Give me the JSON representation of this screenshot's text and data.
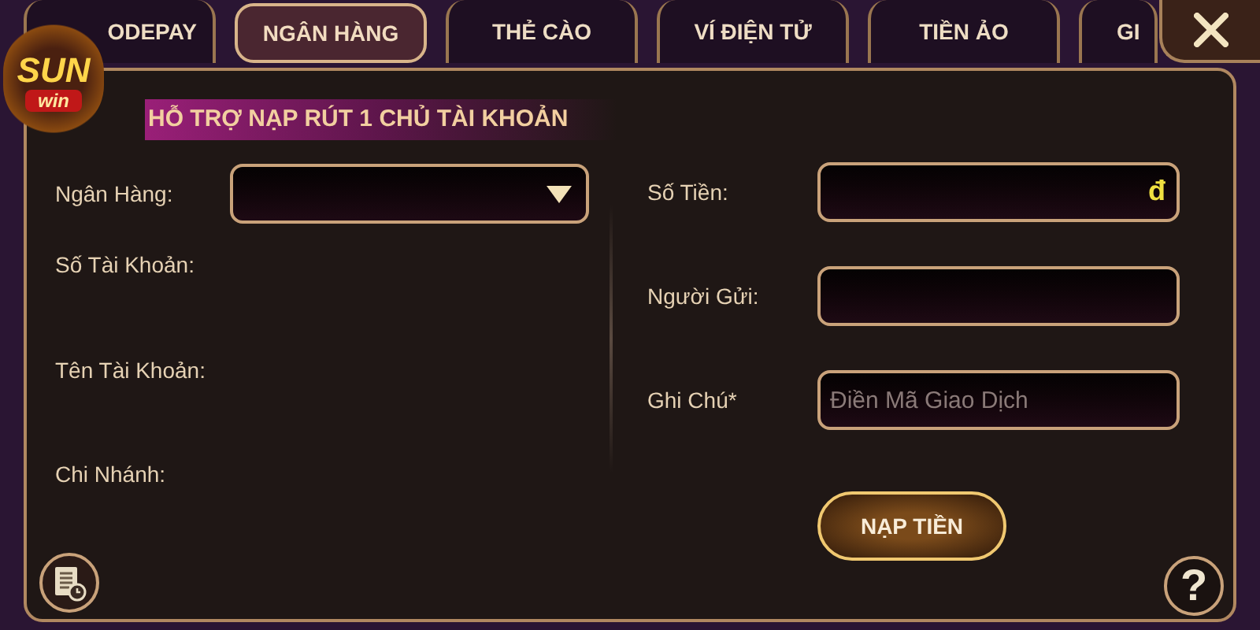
{
  "logo": {
    "top": "SUN",
    "bottom": "win"
  },
  "tabs": [
    {
      "label": "ODEPAY",
      "selected": false
    },
    {
      "label": "NGÂN HÀNG",
      "selected": true
    },
    {
      "label": "THẺ CÀO",
      "selected": false
    },
    {
      "label": "VÍ ĐIỆN TỬ",
      "selected": false
    },
    {
      "label": "TIỀN ẢO",
      "selected": false
    },
    {
      "label": "GI",
      "selected": false
    }
  ],
  "banner": "HỖ TRỢ NẠP RÚT 1 CHỦ TÀI KHOẢN",
  "left_fields": [
    {
      "label": "Ngân Hàng:",
      "kind": "dropdown"
    },
    {
      "label": "Số Tài Khoản:",
      "kind": "text"
    },
    {
      "label": "Tên Tài Khoản:",
      "kind": "text"
    },
    {
      "label": "Chi Nhánh:",
      "kind": "text"
    }
  ],
  "right_fields": [
    {
      "label": "Số Tiền:",
      "kind": "input",
      "suffix": "đ"
    },
    {
      "label": "Người Gửi:",
      "kind": "input"
    },
    {
      "label": "Ghi Chú*",
      "kind": "input",
      "placeholder": "Điền Mã Giao Dịch"
    }
  ],
  "submit": "NẠP TIỀN",
  "help": "?"
}
